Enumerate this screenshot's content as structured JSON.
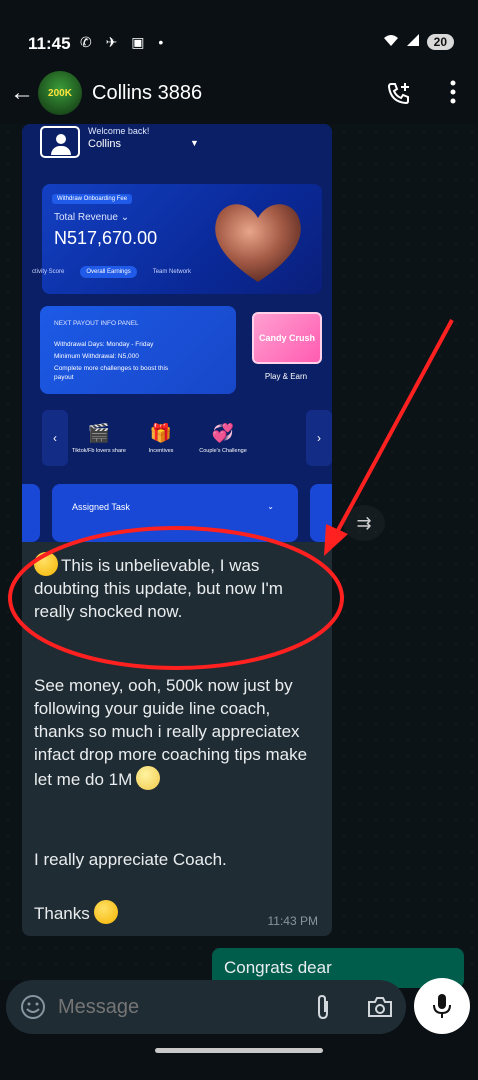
{
  "status_bar": {
    "time": "11:45",
    "battery": "20"
  },
  "header": {
    "avatar_text": "200K",
    "contact_name": "Collins 3886"
  },
  "screenshot": {
    "welcome": "Welcome back!",
    "user": "Collins",
    "withdraw_tag": "Withdraw Onboarding Fee",
    "total_revenue_label": "Total Revenue",
    "revenue_value": "N517,670.00",
    "tabs": [
      "ctivity Score",
      "Overall Earnings",
      "Team Network"
    ],
    "payout_title": "NEXT PAYOUT INFO PANEL",
    "payout_lines": [
      "Withdrawal Days: Monday - Friday",
      "Minimum Withdrawal: N5,000",
      "Complete more challenges to boost this payout"
    ],
    "game_tile": "Candy Crush",
    "game_label": "Play & Earn",
    "shortcuts": [
      "Tiktok/Fb lovers share",
      "Incentives",
      "Couple's Challenge"
    ],
    "assigned_task": "Assigned Task"
  },
  "message": {
    "paragraph1": "This is unbelievable, I was doubting this update, but now I'm really  shocked now.",
    "paragraph2": "See money, ooh, 500k now just by following your guide line coach, thanks so much i really appreciatex infact drop more coaching tips make let me do 1M",
    "paragraph3": "I really appreciate Coach.",
    "paragraph4": "Thanks",
    "time": "11:43 PM"
  },
  "outgoing": {
    "text": "Congrats dear"
  },
  "input": {
    "placeholder": "Message"
  },
  "colors": {
    "annotation": "#ff2020",
    "outgoing_bubble": "#005c4b",
    "incoming_bubble": "#202c33"
  }
}
